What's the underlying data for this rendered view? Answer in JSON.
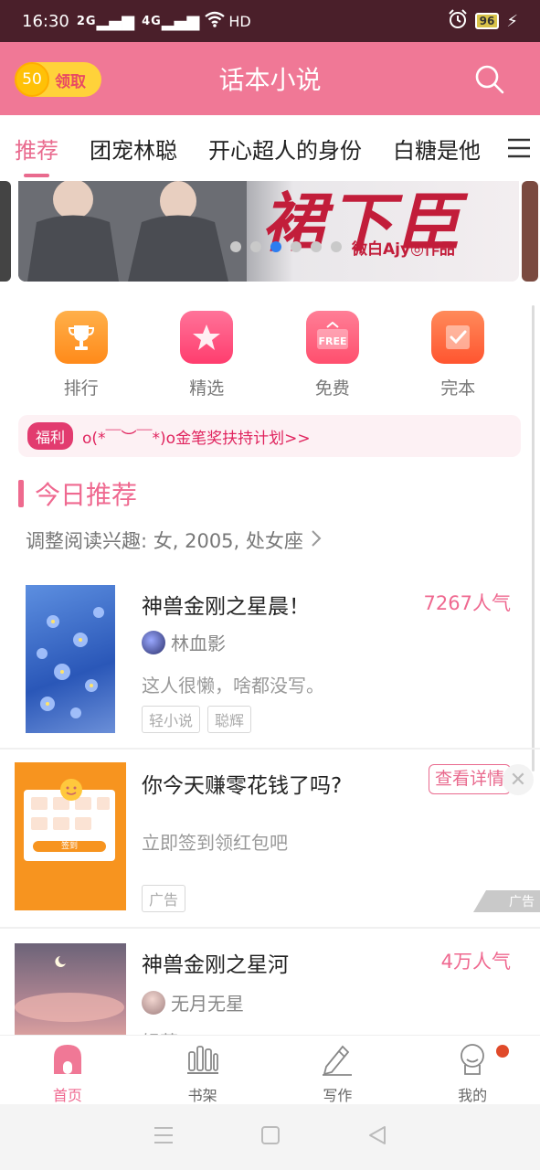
{
  "status_bar": {
    "time": "16:30",
    "signal1": "2G",
    "signal2": "4G",
    "hd": "HD",
    "battery": "96"
  },
  "app_bar": {
    "coin_value": "50",
    "claim_label": "领取",
    "title": "话本小说"
  },
  "tabs": [
    {
      "label": "推荐"
    },
    {
      "label": "团宠林聪"
    },
    {
      "label": "开心超人的身份"
    },
    {
      "label": "白糖是他"
    }
  ],
  "banner": {
    "brand_text": "裙下臣",
    "byline": "微白Ajy◎作品"
  },
  "quick_entries": [
    {
      "label": "排行",
      "icon": "trophy-icon",
      "color": "#ff9a2e"
    },
    {
      "label": "精选",
      "icon": "star-icon",
      "color": "#ff4f7e"
    },
    {
      "label": "免费",
      "icon": "free-icon",
      "color": "#ff5d7a"
    },
    {
      "label": "完本",
      "icon": "check-icon",
      "color": "#ff6a3d"
    }
  ],
  "welfare": {
    "tag": "福利",
    "text": "o(*￣︶￣*)o金笔奖扶持计划>>"
  },
  "section": {
    "title": "今日推荐",
    "interest": "调整阅读兴趣: 女, 2005, 处女座"
  },
  "books": [
    {
      "title": "神兽金刚之星晨！",
      "popularity": "7267人气",
      "author": "林血影",
      "desc": "这人很懒，啥都没写。",
      "tags": [
        "轻小说",
        "聪辉"
      ]
    },
    {
      "title": "神兽金刚之星河",
      "popularity": "4万人气",
      "author": "无月无星",
      "desc": "轻萝"
    }
  ],
  "ad": {
    "title": "你今天赚零花钱了吗?",
    "button": "查看详情",
    "desc": "立即签到领红包吧",
    "tag": "广告",
    "mark": "广告",
    "card_button": "签到"
  },
  "bottom_nav": [
    {
      "label": "首页",
      "icon": "home-icon"
    },
    {
      "label": "书架",
      "icon": "bookshelf-icon"
    },
    {
      "label": "写作",
      "icon": "pen-icon"
    },
    {
      "label": "我的",
      "icon": "profile-icon"
    }
  ]
}
